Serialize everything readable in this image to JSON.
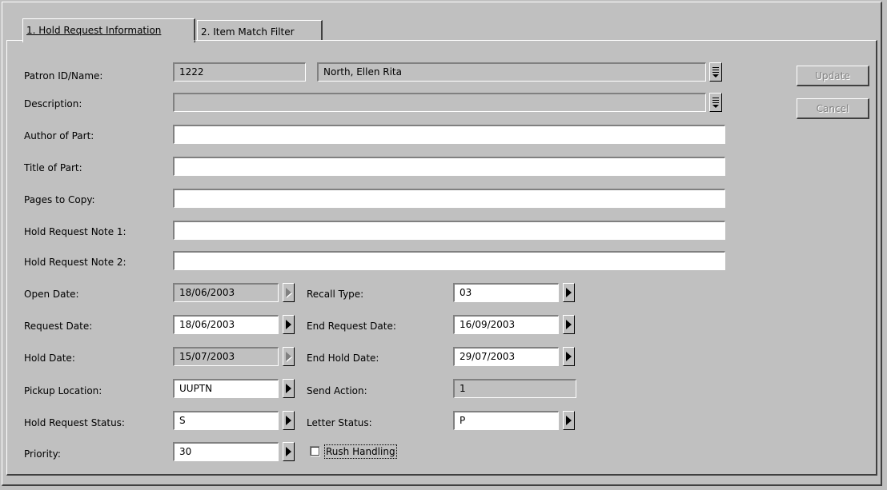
{
  "tabs": [
    {
      "label": "1. Hold Request Information",
      "active": true
    },
    {
      "label": "2. Item Match Filter",
      "active": false
    }
  ],
  "labels": {
    "patron": "Patron ID/Name:",
    "description": "Description:",
    "author": "Author of Part:",
    "title": "Title of Part:",
    "pages": "Pages to Copy:",
    "note1": "Hold Request Note 1:",
    "note2": "Hold Request Note 2:",
    "open_date": "Open Date:",
    "request_date": "Request Date:",
    "hold_date": "Hold Date:",
    "pickup": "Pickup Location:",
    "status": "Hold Request Status:",
    "priority": "Priority:",
    "recall_type": "Recall Type:",
    "end_request_date": "End Request Date:",
    "end_hold_date": "End Hold Date:",
    "send_action": "Send Action:",
    "letter_status": "Letter Status:",
    "rush": "Rush Handling"
  },
  "values": {
    "patron_id": "1222",
    "patron_name": "North, Ellen Rita",
    "description": "",
    "author": "",
    "title": "",
    "pages": "",
    "note1": "",
    "note2": "",
    "open_date": "18/06/2003",
    "request_date": "18/06/2003",
    "hold_date": "15/07/2003",
    "pickup": "UUPTN",
    "status": "S",
    "priority": "30",
    "recall_type": "03",
    "end_request_date": "16/09/2003",
    "end_hold_date": "29/07/2003",
    "send_action": "1",
    "letter_status": "P",
    "rush_checked": false
  },
  "buttons": {
    "update": "Update",
    "cancel": "Cancel"
  }
}
